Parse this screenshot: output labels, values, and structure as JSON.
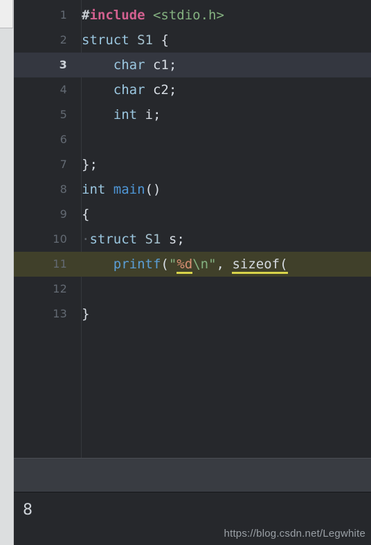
{
  "editor": {
    "current_line": 3,
    "find_match_line": 11,
    "colors": {
      "editor_background": "#26282c",
      "gutter_text": "#636a73",
      "current_line_highlight": "#343740",
      "find_match_highlight": "#40402a",
      "preprocessor": "#d2608f",
      "string": "#84b180",
      "keyword": "#9bc7e0",
      "function": "#4f97d7",
      "format_specifier": "#d98f73",
      "underline": "#d8d44a",
      "rail_background": "#dcdedf"
    },
    "lines": [
      {
        "number": "1",
        "state": "normal",
        "tokens": [
          {
            "t": "#",
            "c": "t-hash"
          },
          {
            "t": "include",
            "c": "t-pp"
          },
          {
            "t": " ",
            "c": "t-plain"
          },
          {
            "t": "<stdio.h>",
            "c": "t-string"
          }
        ]
      },
      {
        "number": "2",
        "state": "normal",
        "tokens": [
          {
            "t": "struct",
            "c": "t-kw"
          },
          {
            "t": " ",
            "c": "t-plain"
          },
          {
            "t": "S1",
            "c": "t-type"
          },
          {
            "t": " ",
            "c": "t-plain"
          },
          {
            "t": "{",
            "c": "t-plain"
          }
        ]
      },
      {
        "number": "3",
        "state": "current",
        "tokens": [
          {
            "t": "    ",
            "c": "t-plain"
          },
          {
            "t": "char",
            "c": "t-kw"
          },
          {
            "t": " ",
            "c": "t-plain"
          },
          {
            "t": "c1;",
            "c": "t-plain"
          }
        ]
      },
      {
        "number": "4",
        "state": "normal",
        "tokens": [
          {
            "t": "    ",
            "c": "t-plain"
          },
          {
            "t": "char",
            "c": "t-kw"
          },
          {
            "t": " ",
            "c": "t-plain"
          },
          {
            "t": "c2;",
            "c": "t-plain"
          }
        ]
      },
      {
        "number": "5",
        "state": "normal",
        "tokens": [
          {
            "t": "    ",
            "c": "t-plain"
          },
          {
            "t": "int",
            "c": "t-kw"
          },
          {
            "t": " ",
            "c": "t-plain"
          },
          {
            "t": "i;",
            "c": "t-plain"
          }
        ]
      },
      {
        "number": "6",
        "state": "normal",
        "tokens": []
      },
      {
        "number": "7",
        "state": "normal",
        "tokens": [
          {
            "t": "};",
            "c": "t-plain"
          }
        ]
      },
      {
        "number": "8",
        "state": "normal",
        "tokens": [
          {
            "t": "int",
            "c": "t-kw"
          },
          {
            "t": " ",
            "c": "t-plain"
          },
          {
            "t": "main",
            "c": "t-fn"
          },
          {
            "t": "()",
            "c": "t-plain"
          }
        ]
      },
      {
        "number": "9",
        "state": "normal",
        "tokens": [
          {
            "t": "{",
            "c": "t-plain"
          }
        ]
      },
      {
        "number": "10",
        "state": "normal",
        "tokens": [
          {
            "t": "·",
            "c": "t-dot"
          },
          {
            "t": "struct",
            "c": "t-kw"
          },
          {
            "t": " ",
            "c": "t-plain"
          },
          {
            "t": "S1",
            "c": "t-type"
          },
          {
            "t": " ",
            "c": "t-plain"
          },
          {
            "t": "s;",
            "c": "t-plain"
          }
        ]
      },
      {
        "number": "11",
        "state": "find",
        "tokens": [
          {
            "t": "    ",
            "c": "t-plain"
          },
          {
            "t": "printf",
            "c": "t-fnlite"
          },
          {
            "t": "(",
            "c": "t-plain"
          },
          {
            "t": "\"",
            "c": "t-string"
          },
          {
            "t": "%d",
            "c": "t-fmt"
          },
          {
            "t": "\\n",
            "c": "t-esc"
          },
          {
            "t": "\"",
            "c": "t-string"
          },
          {
            "t": ", ",
            "c": "t-plain"
          },
          {
            "t": "sizeof(",
            "c": "t-under"
          }
        ]
      },
      {
        "number": "12",
        "state": "normal",
        "tokens": []
      },
      {
        "number": "13",
        "state": "normal",
        "tokens": [
          {
            "t": "}",
            "c": "t-plain"
          }
        ]
      }
    ]
  },
  "console": {
    "output": "8"
  },
  "watermark": {
    "text": "https://blog.csdn.net/Legwhite"
  }
}
